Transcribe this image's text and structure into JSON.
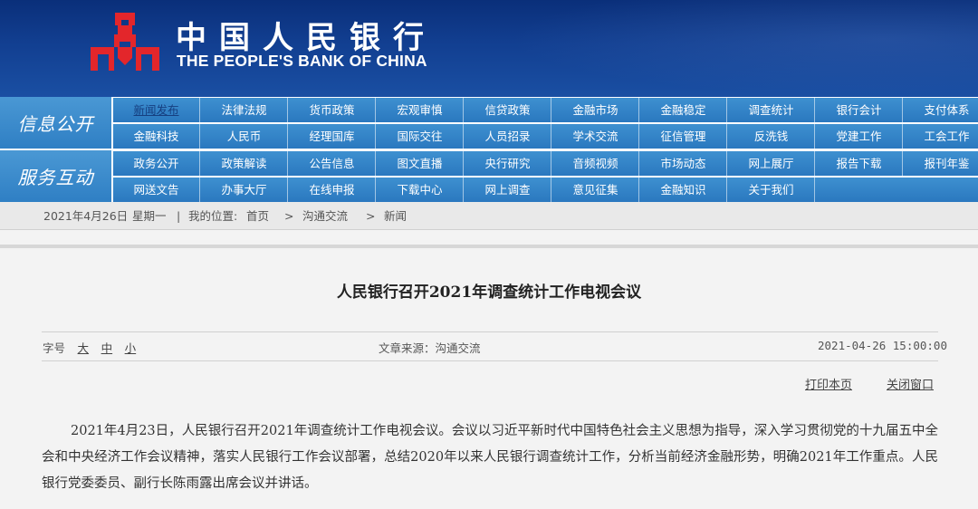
{
  "header": {
    "bank_name_cn": "中国人民银行",
    "bank_name_en": "THE PEOPLE'S BANK OF CHINA",
    "brand_colors": {
      "logo_red": "#e3262b",
      "header_blue": "#123f91",
      "nav_blue": "#3286c8"
    }
  },
  "nav": {
    "sections": [
      {
        "label": "信息公开",
        "rows": [
          [
            "新闻发布",
            "法律法规",
            "货币政策",
            "宏观审慎",
            "信贷政策",
            "金融市场",
            "金融稳定",
            "调查统计",
            "银行会计",
            "支付体系"
          ],
          [
            "金融科技",
            "人民币",
            "经理国库",
            "国际交往",
            "人员招录",
            "学术交流",
            "征信管理",
            "反洗钱",
            "党建工作",
            "工会工作"
          ]
        ]
      },
      {
        "label": "服务互动",
        "rows": [
          [
            "政务公开",
            "政策解读",
            "公告信息",
            "图文直播",
            "央行研究",
            "音频视频",
            "市场动态",
            "网上展厅",
            "报告下载",
            "报刊年鉴"
          ],
          [
            "网送文告",
            "办事大厅",
            "在线申报",
            "下载中心",
            "网上调查",
            "意见征集",
            "金融知识",
            "关于我们"
          ]
        ]
      }
    ],
    "active_item": "新闻发布"
  },
  "breadcrumb": {
    "date": "2021年4月26日",
    "weekday": "星期一",
    "location_prefix": "我的位置:",
    "items": [
      "首页",
      "沟通交流",
      "新闻"
    ],
    "separator": ">",
    "divider": "|"
  },
  "article": {
    "title": "人民银行召开2021年调查统计工作电视会议",
    "font_size_label": "字号",
    "font_sizes": [
      "大",
      "中",
      "小"
    ],
    "source": "文章来源：沟通交流",
    "datetime": "2021-04-26 15:00:00",
    "print_label": "打印本页",
    "close_label": "关闭窗口",
    "body": "2021年4月23日，人民银行召开2021年调查统计工作电视会议。会议以习近平新时代中国特色社会主义思想为指导，深入学习贯彻党的十九届五中全会和中央经济工作会议精神，落实人民银行工作会议部署，总结2020年以来人民银行调查统计工作，分析当前经济金融形势，明确2021年工作重点。人民银行党委委员、副行长陈雨露出席会议并讲话。"
  }
}
